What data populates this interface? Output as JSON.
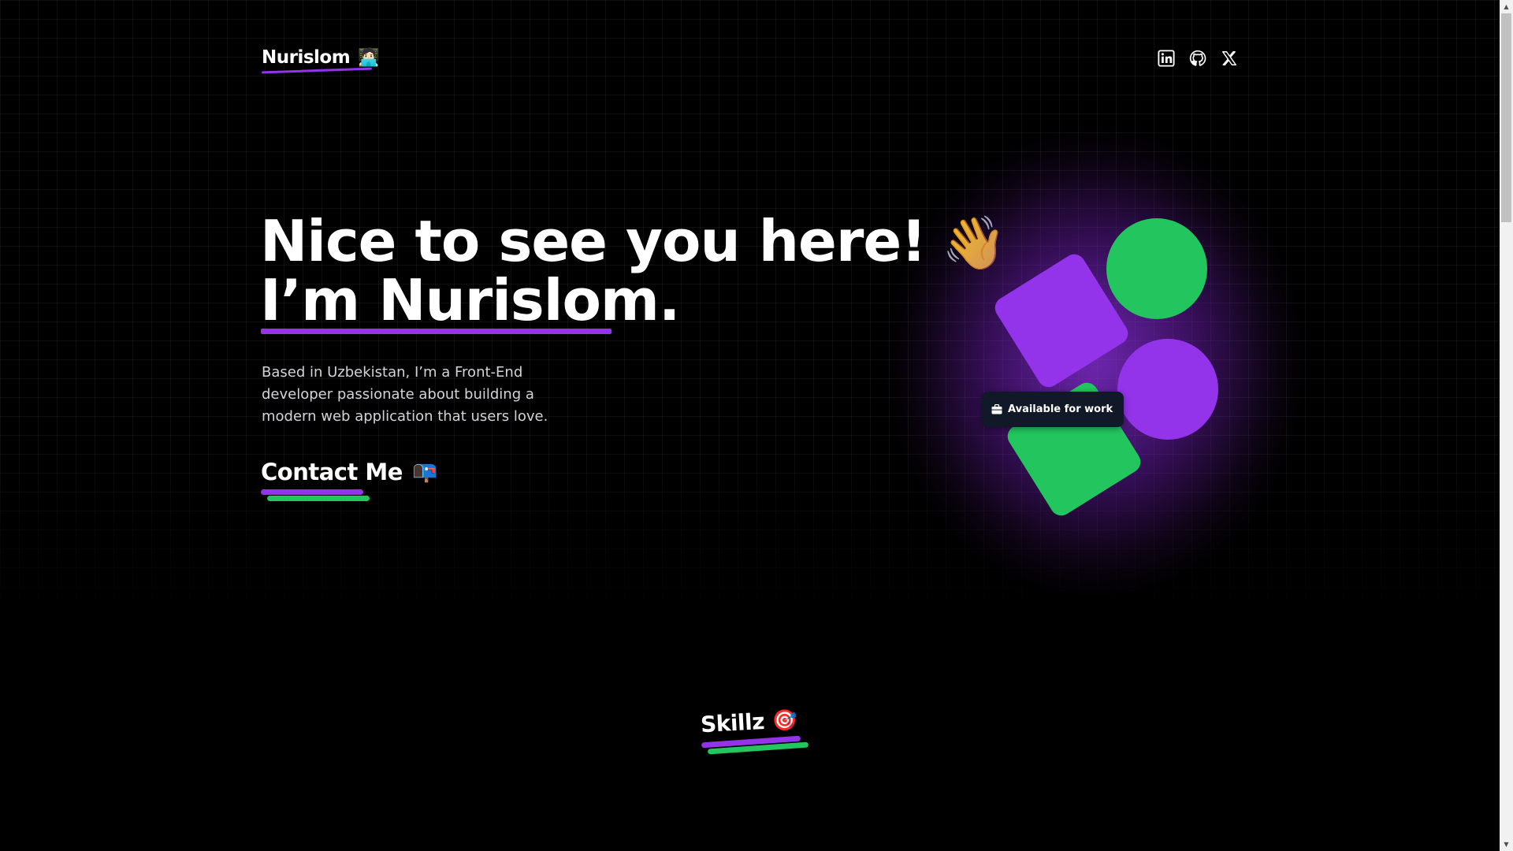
{
  "header": {
    "logo_text": "Nurislom",
    "logo_emoji": "🧑🏻‍💻",
    "socials": [
      {
        "name": "linkedin-icon"
      },
      {
        "name": "github-icon"
      },
      {
        "name": "x-icon"
      }
    ]
  },
  "hero": {
    "headline_line1": "Nice to see you here!",
    "wave_emoji": "👋",
    "headline_line2": "I’m Nurislom.",
    "intro": "Based in Uzbekistan, I’m a Front-End developer passionate about building a modern web application that users love.",
    "contact_label": "Contact Me",
    "contact_emoji": "📭",
    "badge_icon": "briefcase-icon",
    "badge_label": "Available for work"
  },
  "skills": {
    "title": "Skillz",
    "emoji": "🎯"
  },
  "colors": {
    "background": "#000000",
    "purple": "#9333ea",
    "green": "#22c55e",
    "badge_bg": "#111827",
    "intro_text": "#d4d4d8"
  },
  "scrollbar": {
    "up_glyph": "▲",
    "down_glyph": "▼"
  }
}
